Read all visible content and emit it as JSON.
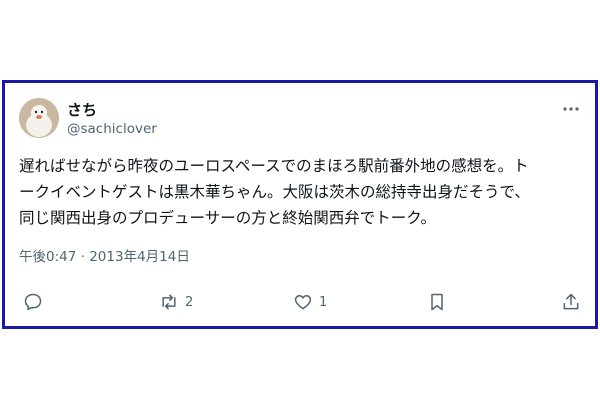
{
  "tweet": {
    "display_name": "さち",
    "handle": "@sachiclover",
    "body_lines": [
      "遅ればせながら昨夜のユーロスペースでのまほろ駅前番外地の感想を。ト",
      "ークイベントゲストは黒木華ちゃん。大阪は茨木の総持寺出身だそうで、",
      "同じ関西出身のプロデューサーの方と終始関西弁でトーク。"
    ],
    "timestamp": "午後0:47 · 2013年4月14日",
    "retweet_count": "2",
    "like_count": "1"
  },
  "icons": [
    "more-icon",
    "reply-icon",
    "retweet-icon",
    "like-icon",
    "bookmark-icon",
    "share-icon"
  ],
  "colors": {
    "frame": "#1a1aa6",
    "secondary_text": "#536471"
  }
}
